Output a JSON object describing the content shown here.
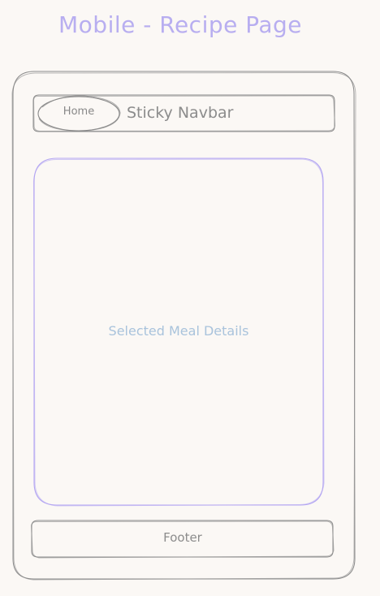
{
  "page": {
    "title": "Mobile - Recipe Page"
  },
  "navbar": {
    "home_label": "Home",
    "label": "Sticky Navbar"
  },
  "content": {
    "label": "Selected Meal Details"
  },
  "footer": {
    "label": "Footer"
  },
  "colors": {
    "background": "#fbf8f5",
    "title": "#b8aef0",
    "outline": "#8a8a8a",
    "content_border": "#b3a5f2",
    "content_text": "#a9c3dc"
  }
}
